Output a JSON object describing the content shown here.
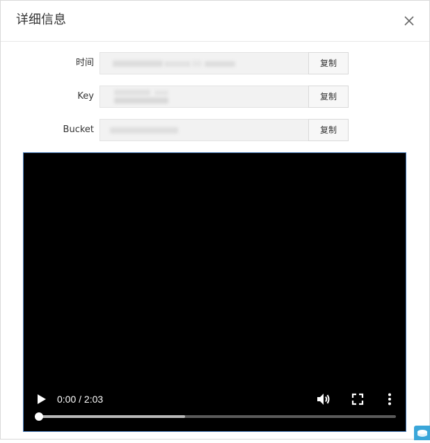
{
  "dialog": {
    "title": "详细信息",
    "close_icon": "close-icon"
  },
  "fields": [
    {
      "label": "时间",
      "value": "",
      "copy_label": "复制"
    },
    {
      "label": "Key",
      "value": "",
      "copy_label": "复制"
    },
    {
      "label": "Bucket",
      "value": "",
      "copy_label": "复制"
    }
  ],
  "video_player": {
    "time_display": "0:00 / 2:03",
    "played_fraction": 0.0,
    "buffered_fraction": 0.41,
    "play_icon": "play-icon",
    "volume_icon": "volume-icon",
    "fullscreen_icon": "fullscreen-icon",
    "more_icon": "more-options-icon"
  },
  "colors": {
    "video_background": "#000000",
    "corner_badge": "#3aa6d9"
  },
  "corner_badge_icon": "storage-icon"
}
